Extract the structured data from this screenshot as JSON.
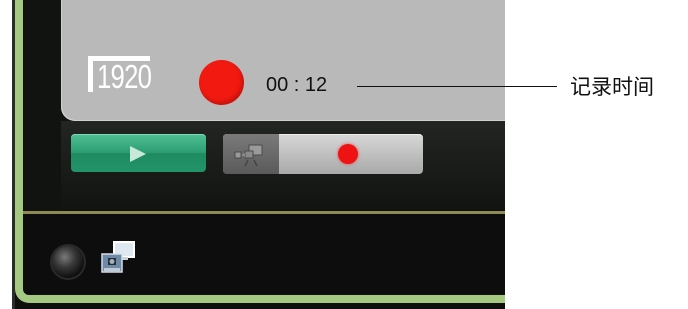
{
  "screen": {
    "resolution_label": "1920",
    "record_time": "00 : 12"
  },
  "controls": {
    "play_icon": "play-icon",
    "camera_icon": "video-camera-icon",
    "record_icon": "record-dot-icon",
    "power_icon": "power-button-icon",
    "display_icon": "display-mode-icon"
  },
  "callout": {
    "label": "记录时间"
  },
  "colors": {
    "border_green": "#a6c982",
    "record_red": "#f21a10",
    "play_green": "#2e9f74",
    "panel_gray": "#b9b9b9"
  }
}
